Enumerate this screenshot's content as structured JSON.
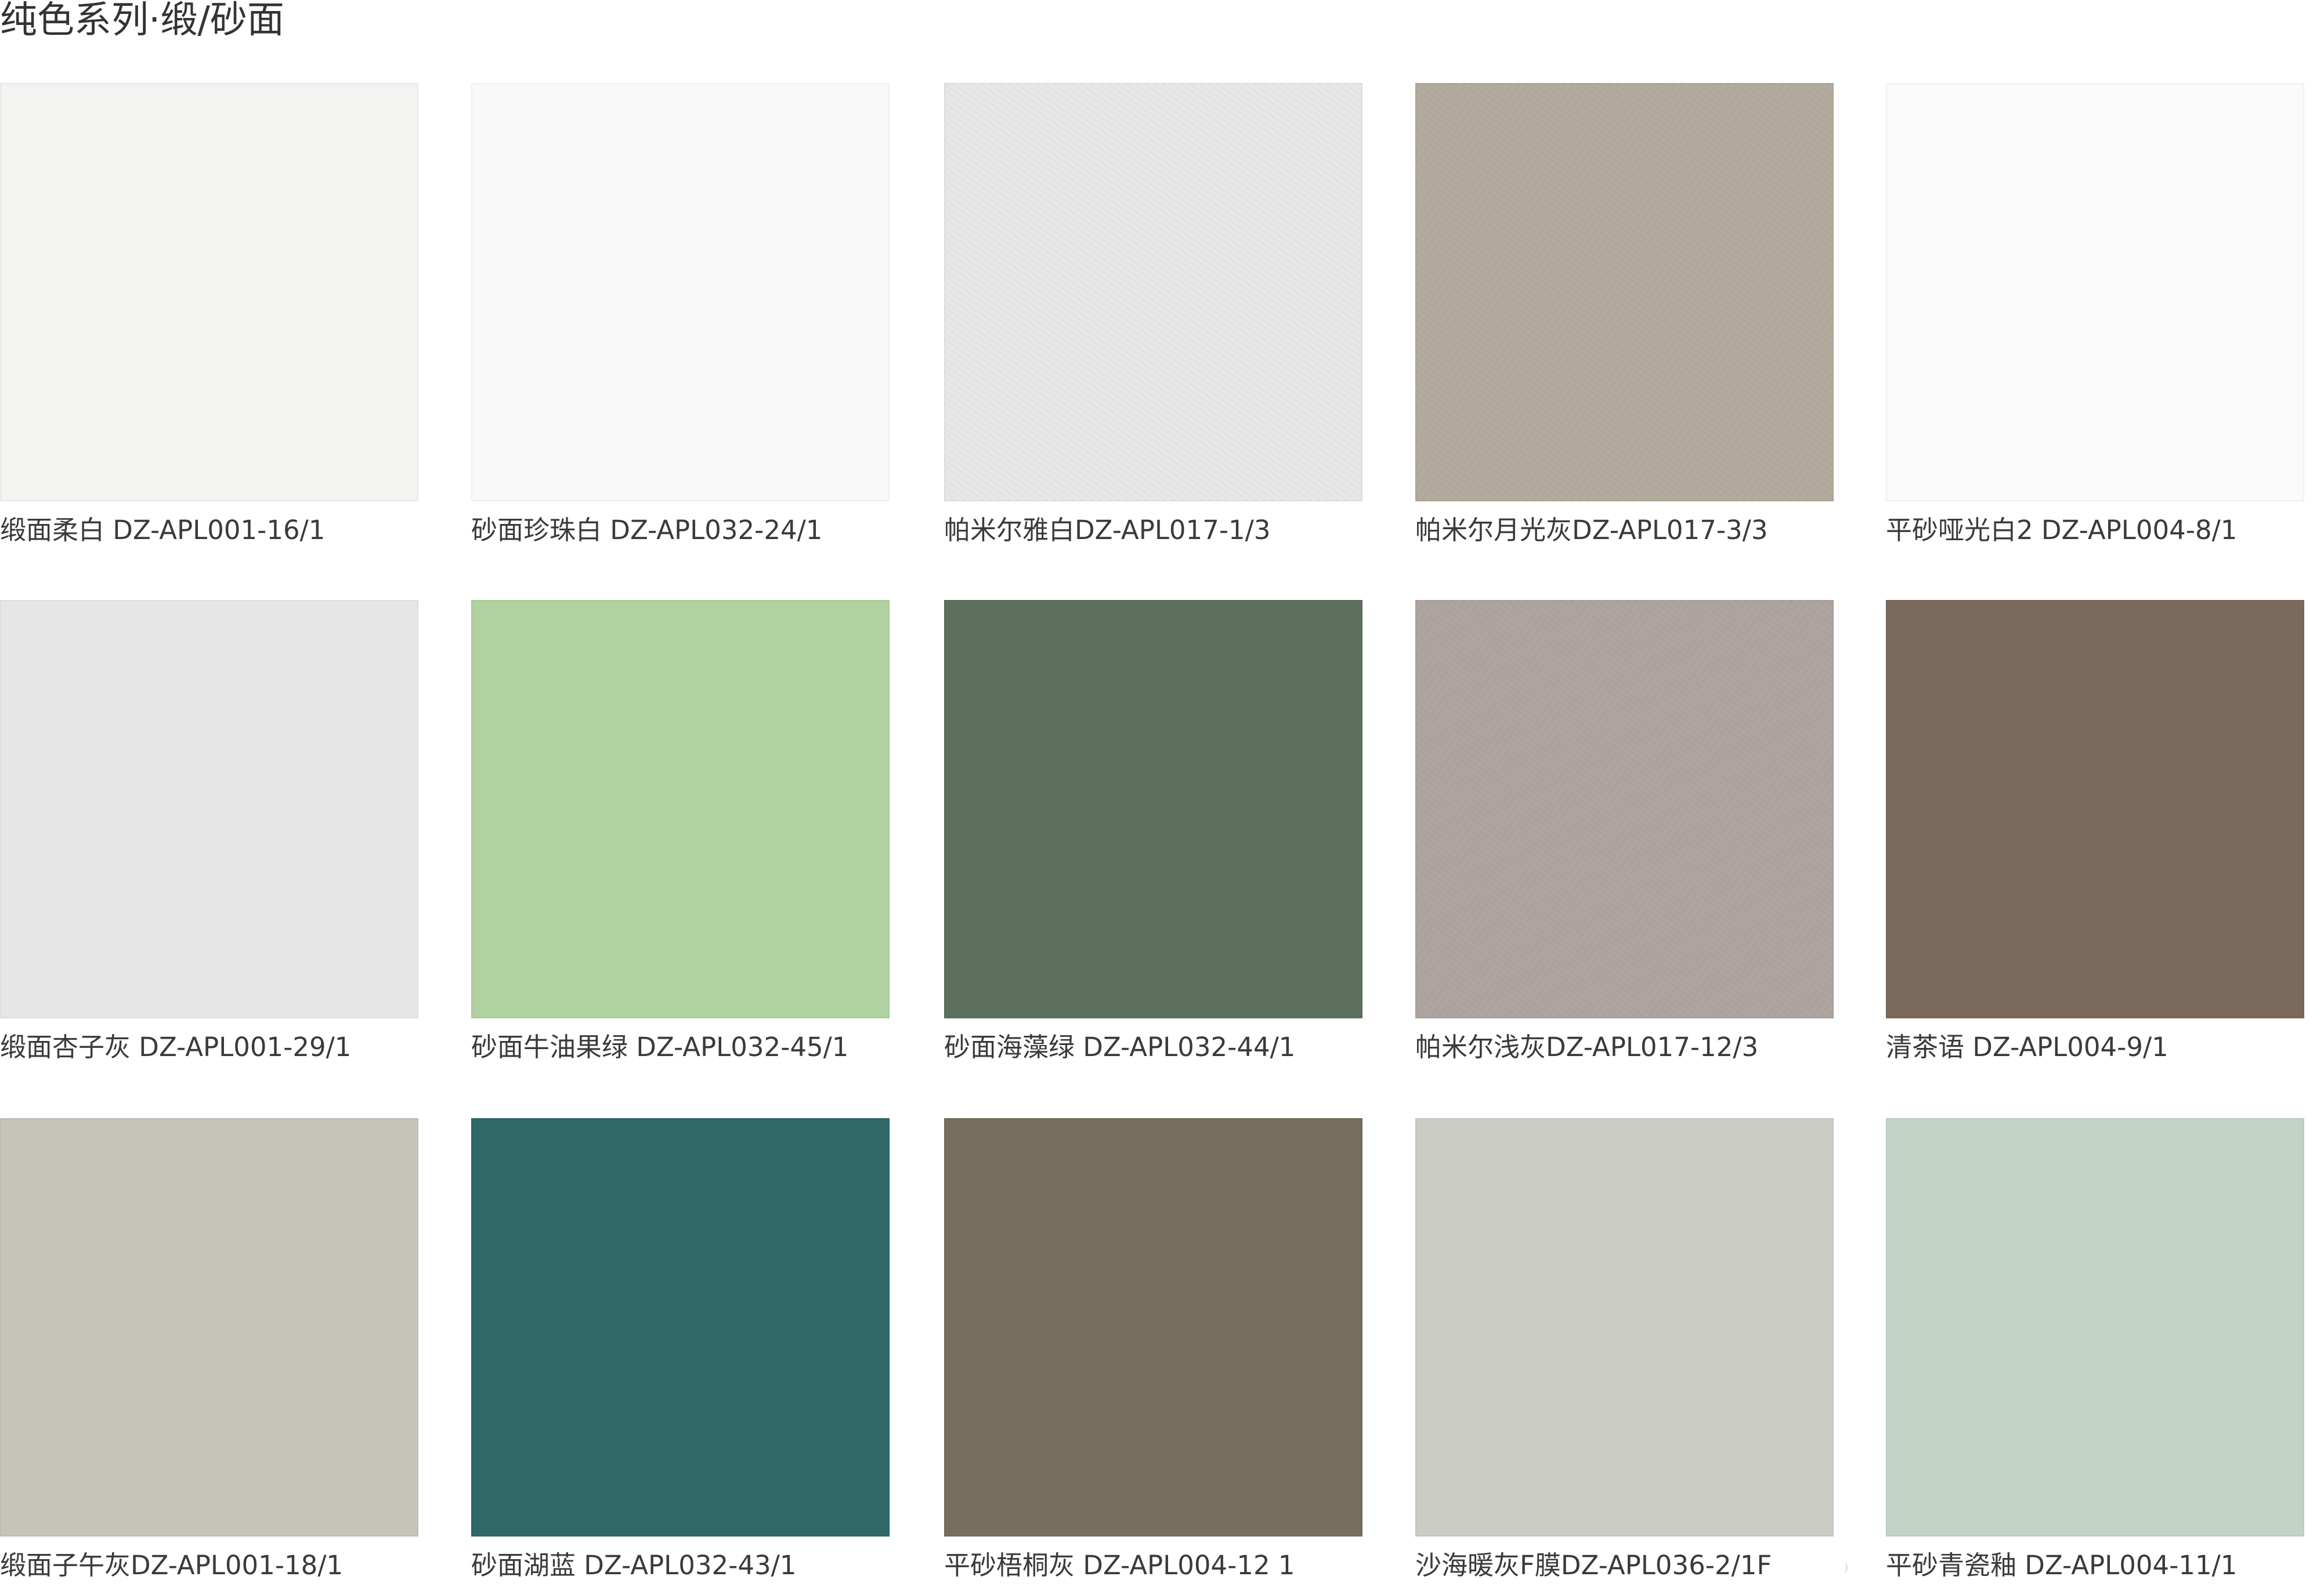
{
  "page": {
    "title": "纯色系列·缎/砂面"
  },
  "swatches": [
    {
      "label": "缎面柔白 DZ-APL001-16/1",
      "color": "#f3f4f2",
      "textured": false
    },
    {
      "label": "砂面珍珠白 DZ-APL032-24/1",
      "color": "#f9f9f9",
      "textured": false
    },
    {
      "label": "帕米尔雅白DZ-APL017-1/3",
      "color": "#e7e7e7",
      "textured": true
    },
    {
      "label": "帕米尔月光灰DZ-APL017-3/3",
      "color": "#b3aa9d",
      "textured": true
    },
    {
      "label": "平砂哑光白2 DZ-APL004-8/1",
      "color": "#fafafa",
      "textured": false
    },
    {
      "label": "缎面杏子灰 DZ-APL001-29/1",
      "color": "#e6e6e6",
      "textured": false
    },
    {
      "label": "砂面牛油果绿 DZ-APL032-45/1",
      "color": "#b0d2a0",
      "textured": false
    },
    {
      "label": "砂面海藻绿 DZ-APL032-44/1",
      "color": "#5c6e5c",
      "textured": false
    },
    {
      "label": "帕米尔浅灰DZ-APL017-12/3",
      "color": "#aea49f",
      "textured": true
    },
    {
      "label": "清茶语 DZ-APL004-9/1",
      "color": "#7b695b",
      "textured": false
    },
    {
      "label": "缎面子午灰DZ-APL001-18/1",
      "color": "#c4c4ba",
      "textured": false
    },
    {
      "label": "砂面湖蓝 DZ-APL032-43/1",
      "color": "#2f6868",
      "textured": false
    },
    {
      "label": "平砂梧桐灰 DZ-APL004-12 1",
      "color": "#766f5f",
      "textured": false
    },
    {
      "label": "沙海暖灰F膜DZ-APL036-2/1F",
      "color": "#cbccc3",
      "textured": false
    },
    {
      "label": "平砂青瓷釉 DZ-APL004-11/1",
      "color": "#c1d4c5",
      "textured": false
    }
  ],
  "stray_mark": "⁾"
}
